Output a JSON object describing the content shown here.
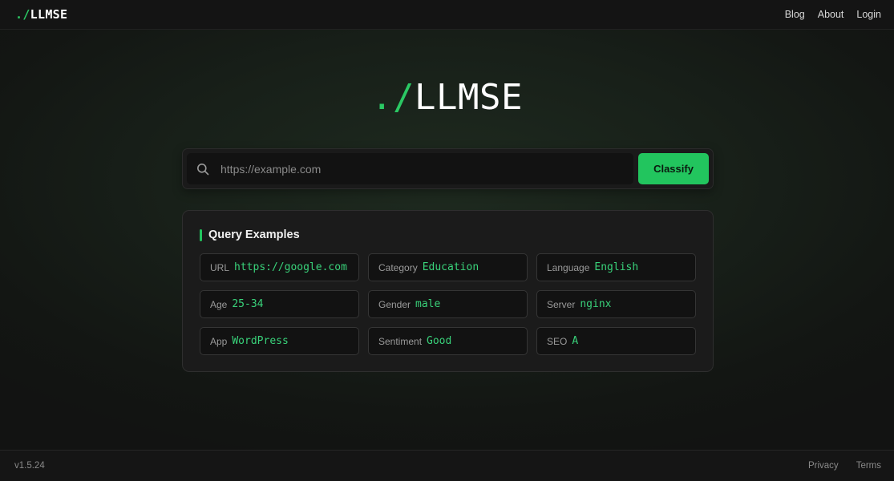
{
  "header": {
    "brand_prefix": "./",
    "brand_name": "LLMSE",
    "nav": [
      "Blog",
      "About",
      "Login"
    ]
  },
  "hero": {
    "prefix": "./",
    "name": "LLMSE"
  },
  "search": {
    "placeholder": "https://example.com",
    "value": "",
    "icon": "search-icon",
    "button_label": "Classify"
  },
  "examples": {
    "title": "Query Examples",
    "items": [
      {
        "key": "URL",
        "value": "https://google.com"
      },
      {
        "key": "Category",
        "value": "Education"
      },
      {
        "key": "Language",
        "value": "English"
      },
      {
        "key": "Age",
        "value": "25-34"
      },
      {
        "key": "Gender",
        "value": "male"
      },
      {
        "key": "Server",
        "value": "nginx"
      },
      {
        "key": "App",
        "value": "WordPress"
      },
      {
        "key": "Sentiment",
        "value": "Good"
      },
      {
        "key": "SEO",
        "value": "A"
      }
    ]
  },
  "footer": {
    "version": "v1.5.24",
    "links": [
      "Privacy",
      "Terms"
    ]
  },
  "colors": {
    "accent": "#22c55e",
    "value_text": "#39d27a",
    "background": "#131613"
  }
}
